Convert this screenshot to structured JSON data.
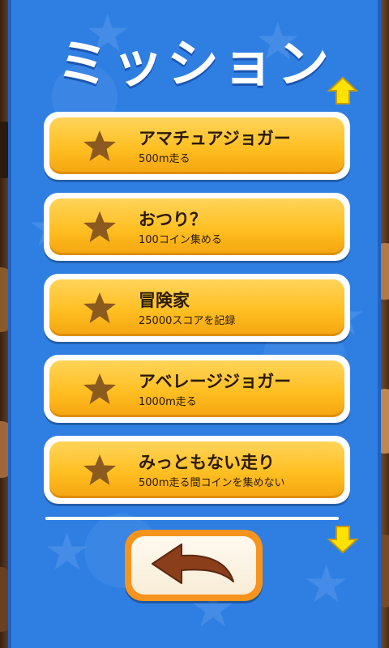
{
  "screen": {
    "title": "ミッション"
  },
  "navigation": {
    "scroll_up_icon": "arrow-up-icon",
    "scroll_down_icon": "arrow-down-icon",
    "back_icon": "back-arrow-icon"
  },
  "missions": [
    {
      "name": "アマチュアジョガー",
      "desc": "500m走る"
    },
    {
      "name": "おつり？",
      "desc": "100コイン集める"
    },
    {
      "name": "冒険家",
      "desc": "25000スコアを記録"
    },
    {
      "name": "アベレージジョガー",
      "desc": "1000m走る"
    },
    {
      "name": "みっともない走り",
      "desc": "500m走る間コインを集めない"
    }
  ],
  "colors": {
    "panel": "#2f7fe3",
    "button": "#ffbf22",
    "star": "#8a5a1e",
    "arrow": "#ffe200",
    "back_border": "#f7941d"
  }
}
